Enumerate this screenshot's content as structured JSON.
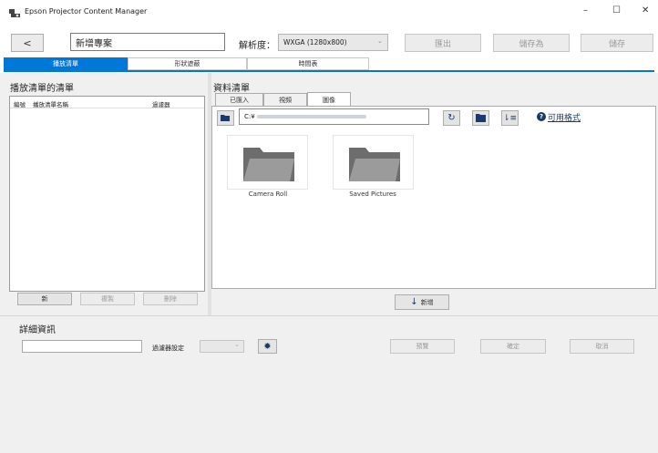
{
  "window": {
    "title": "Epson Projector Content Manager",
    "minimize": "–",
    "maximize": "☐",
    "close": "✕"
  },
  "toolbar": {
    "back": "<",
    "project_name": "新增專案",
    "resolution_label": "解析度：",
    "resolution_value": "WXGA (1280x800)",
    "export_label": "匯出",
    "save_as_label": "儲存為",
    "save_label": "儲存"
  },
  "main_tabs": [
    {
      "label": "播放清單",
      "active": true
    },
    {
      "label": "形狀遮蔽",
      "active": false
    },
    {
      "label": "時間表",
      "active": false
    }
  ],
  "playlist_panel": {
    "title": "播放清單的清單",
    "columns": [
      "編號",
      "播放清單名稱",
      "過濾器"
    ],
    "new_label": "新",
    "copy_label": "複製",
    "delete_label": "刪除"
  },
  "data_panel": {
    "title": "資料清單",
    "tabs": [
      {
        "label": "已匯入",
        "active": false
      },
      {
        "label": "視頻",
        "active": false
      },
      {
        "label": "圖像",
        "active": true
      }
    ],
    "path_value": "C:¥",
    "supported_formats_label": "可用格式",
    "items": [
      {
        "label": "Camera Roll"
      },
      {
        "label": "Saved Pictures"
      }
    ],
    "add_label": "新增"
  },
  "details": {
    "title": "詳細資訊",
    "filter_label": "過濾器設定",
    "preview_label": "預覽",
    "ok_label": "確定",
    "cancel_label": "取消"
  }
}
